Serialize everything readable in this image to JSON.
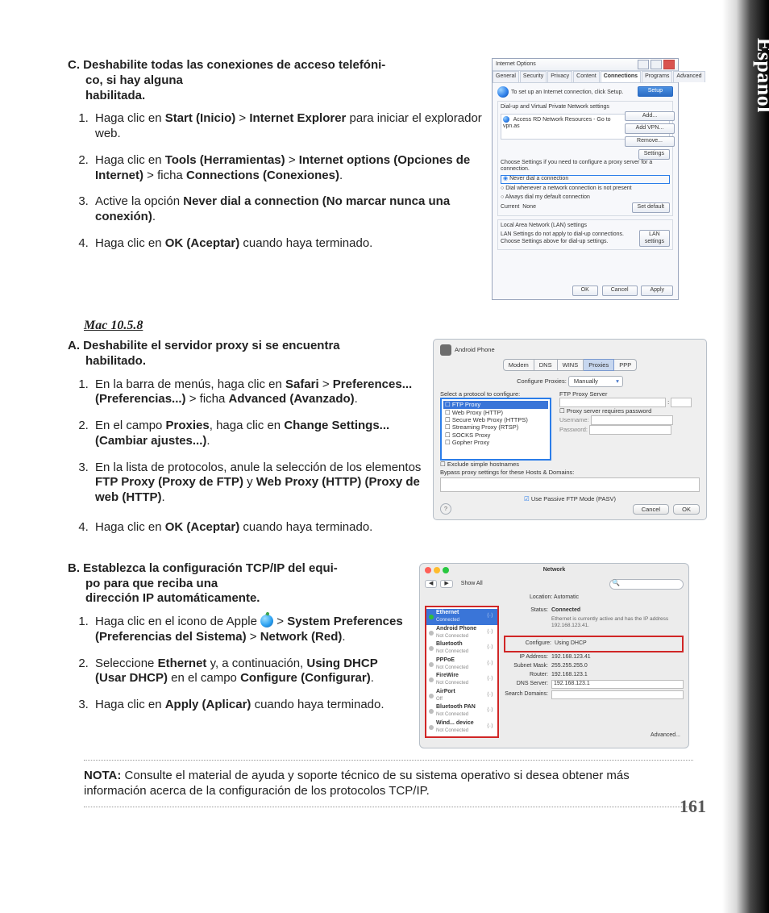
{
  "sideTab": "Español",
  "pageNumber": "161",
  "sectionC": {
    "letter": "C.",
    "line1": "Deshabilite todas las conexiones de acceso telefóni-",
    "line2": "co, si hay alguna",
    "line3": "habilitada."
  },
  "listC": {
    "i1a": "Haga clic en ",
    "i1b": "Start (Inicio)",
    "i1c": " > ",
    "i1d": "Internet Explorer",
    "i1e": " para iniciar el explorador web.",
    "i2a": "Haga clic en ",
    "i2b": "Tools (Herramientas)",
    "i2c": " > ",
    "i2d": "Internet options (Opciones de Internet)",
    "i2e": " > ficha ",
    "i2f": "Connections (Conexiones)",
    "i2g": ".",
    "i3a": "Active la opción ",
    "i3b": "Never dial a connection (No marcar nunca una conexión)",
    "i3c": ".",
    "i4a": "Haga clic en ",
    "i4b": "OK (Aceptar)",
    "i4c": " cuando haya terminado."
  },
  "macHeading": "Mac 10.5.8",
  "sectionA": {
    "letter": "A.",
    "line1": "Deshabilite el servidor proxy si se encuentra",
    "line2": "habilitado."
  },
  "listA": {
    "i1a": "En la barra de menús, haga clic en ",
    "i1b": "Safari",
    "i1c": " > ",
    "i1d": "Preferences... (Preferencias...)",
    "i1e": " > ficha ",
    "i1f": "Advanced (Avanzado)",
    "i1g": ".",
    "i2a": "En el campo ",
    "i2b": "Proxies",
    "i2c": ", haga clic en ",
    "i2d": "Change Settings... (Cambiar ajustes...)",
    "i2e": ".",
    "i3a": "En la lista de protocolos, anule la selección de los elementos ",
    "i3b": "FTP Proxy (Proxy de FTP)",
    "i3c": " y ",
    "i3d": "Web Proxy (HTTP) (Proxy de web (HTTP)",
    "i3e": ".",
    "i4a": "Haga clic en ",
    "i4b": "OK (Aceptar)",
    "i4c": " cuando haya terminado."
  },
  "sectionB": {
    "letter": "B.",
    "line1": "Establezca la configuración TCP/IP del equi-",
    "line2": "po para que reciba una",
    "line3": "dirección IP automáticamente."
  },
  "listB": {
    "i1a": "Haga clic en el icono de Apple ",
    "i1b": " > ",
    "i1c": "System Preferences (Preferencias del Sistema)",
    "i1d": " > ",
    "i1e": "Network (Red)",
    "i1f": ".",
    "i2a": "Seleccione ",
    "i2b": "Ethernet",
    "i2c": " y, a continuación, ",
    "i2d": "Using DHCP (Usar DHCP)",
    "i2e": " en el campo ",
    "i2f": "Configure (Configurar)",
    "i2g": ".",
    "i3a": "Haga clic en ",
    "i3b": "Apply (Aplicar)",
    "i3c": "  cuando haya terminado."
  },
  "note": {
    "label": "NOTA:",
    "text": " Consulte el material de ayuda y soporte técnico de su sistema operativo si desea obtener más información acerca de la configuración de los protocolos TCP/IP."
  },
  "fig1": {
    "title": "Internet Options",
    "tabs": [
      "General",
      "Security",
      "Privacy",
      "Content",
      "Connections",
      "Programs",
      "Advanced"
    ],
    "setupLine": "To set up an Internet connection, click Setup.",
    "setupBtn": "Setup",
    "dialGroup": "Dial-up and Virtual Private Network settings",
    "vpnItem": "Access RD Network Resources - Go to vpn.as",
    "addBtn": "Add...",
    "addVpnBtn": "Add VPN...",
    "removeBtn": "Remove...",
    "settingsBtn": "Settings",
    "chooseLine": "Choose Settings if you need to configure a proxy server for a connection.",
    "radioNever": "Never dial a connection",
    "radioWhen": "Dial whenever a network connection is not present",
    "radioAlways": "Always dial my default connection",
    "currentLbl": "Current",
    "currentVal": "None",
    "setDefault": "Set default",
    "lanGroup": "Local Area Network (LAN) settings",
    "lanLine": "LAN Settings do not apply to dial-up connections. Choose Settings above for dial-up settings.",
    "lanBtn": "LAN settings",
    "ok": "OK",
    "cancel": "Cancel",
    "apply": "Apply"
  },
  "fig2": {
    "device": "Android Phone",
    "tabs": [
      "Modem",
      "DNS",
      "WINS",
      "Proxies",
      "PPP"
    ],
    "cfgLabel": "Configure Proxies:",
    "cfgValue": "Manually",
    "leftLabel": "Select a protocol to configure:",
    "protocols": [
      "FTP Proxy",
      "Web Proxy (HTTP)",
      "Secure Web Proxy (HTTPS)",
      "Streaming Proxy (RTSP)",
      "SOCKS Proxy",
      "Gopher Proxy"
    ],
    "exclude": "Exclude simple hostnames",
    "rightLabel": "FTP Proxy Server",
    "reqPass": "Proxy server requires password",
    "user": "Username:",
    "pass": "Password:",
    "bypass": "Bypass proxy settings for these Hosts & Domains:",
    "pasv": "Use Passive FTP Mode (PASV)",
    "help": "?",
    "cancel": "Cancel",
    "ok": "OK"
  },
  "fig3": {
    "title": "Network",
    "showAll": "Show All",
    "locLabel": "Location:",
    "locValue": "Automatic",
    "services": [
      {
        "name": "Ethernet",
        "sub": "Connected",
        "sel": true,
        "led": "on"
      },
      {
        "name": "Android Phone",
        "sub": "Not Connected",
        "led": "off"
      },
      {
        "name": "Bluetooth",
        "sub": "Not Connected",
        "led": "off"
      },
      {
        "name": "PPPoE",
        "sub": "Not Connected",
        "led": "off"
      },
      {
        "name": "FireWire",
        "sub": "Not Connected",
        "led": "off"
      },
      {
        "name": "AirPort",
        "sub": "Off",
        "led": "off"
      },
      {
        "name": "Bluetooth PAN",
        "sub": "Not Connected",
        "led": "off"
      },
      {
        "name": "Wind... device",
        "sub": "Not Connected",
        "led": "off"
      }
    ],
    "statusLbl": "Status:",
    "statusVal": "Connected",
    "statusSub": "Ethernet is currently active and has the IP address 192.168.123.41.",
    "cfgLbl": "Configure:",
    "cfgVal": "Using DHCP",
    "ipLbl": "IP Address:",
    "ipVal": "192.168.123.41",
    "maskLbl": "Subnet Mask:",
    "maskVal": "255.255.255.0",
    "routerLbl": "Router:",
    "routerVal": "192.168.123.1",
    "dnsLbl": "DNS Server:",
    "dnsVal": "192.168.123.1",
    "searchLbl": "Search Domains:",
    "adv": "Advanced..."
  }
}
